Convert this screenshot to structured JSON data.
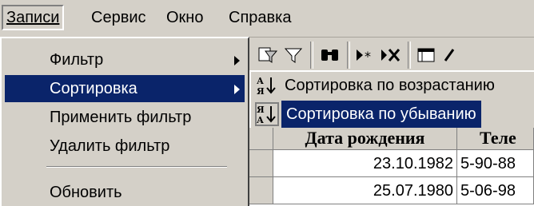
{
  "menubar": {
    "items": [
      {
        "label": "Записи",
        "active": true
      },
      {
        "label": "Сервис"
      },
      {
        "label": "Окно"
      },
      {
        "label": "Справка"
      }
    ]
  },
  "menu": {
    "items": [
      {
        "label": "Фильтр",
        "submenu": true
      },
      {
        "label": "Сортировка",
        "submenu": true,
        "highlighted": true
      },
      {
        "label": "Применить фильтр"
      },
      {
        "label": "Удалить фильтр"
      },
      {
        "label": "Обновить"
      }
    ]
  },
  "submenu": {
    "items": [
      {
        "label": "Сортировка по возрастанию",
        "icon": "sort-ascending-icon"
      },
      {
        "label": "Сортировка по убыванию",
        "icon": "sort-descending-icon",
        "highlighted": true
      }
    ]
  },
  "grid": {
    "columns": [
      "Дата рождения",
      "Теле"
    ],
    "rows": [
      [
        "23.10.1982",
        "5-90-88"
      ],
      [
        "25.07.1980",
        "5-06-98"
      ]
    ]
  },
  "colors": {
    "highlight": "#0a246a",
    "face": "#d4d0c8"
  }
}
